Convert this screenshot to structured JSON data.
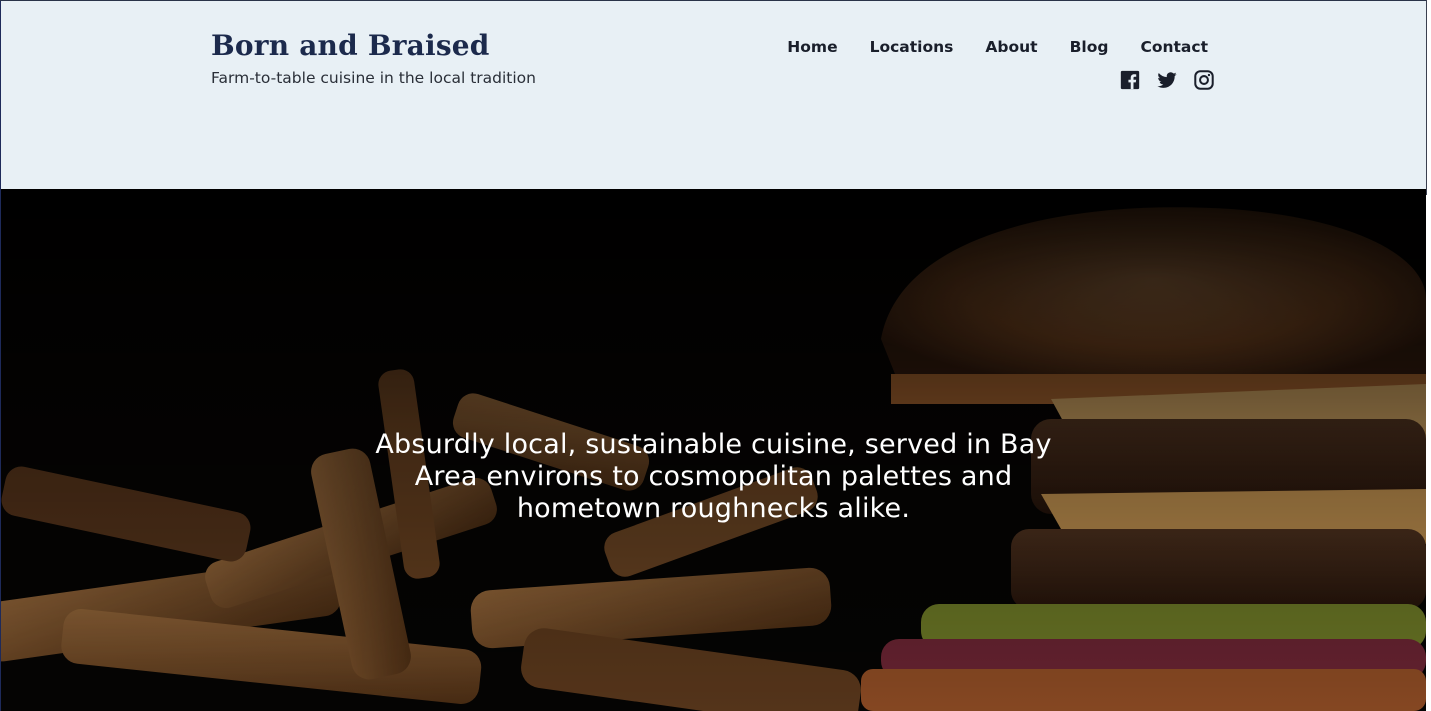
{
  "site": {
    "title": "Born and Braised",
    "tagline": "Farm-to-table cuisine in the local tradition"
  },
  "nav": {
    "items": [
      {
        "label": "Home"
      },
      {
        "label": "Locations"
      },
      {
        "label": "About"
      },
      {
        "label": "Blog"
      },
      {
        "label": "Contact"
      }
    ]
  },
  "social": {
    "icons": [
      "facebook-icon",
      "twitter-icon",
      "instagram-icon"
    ]
  },
  "hero": {
    "headline": "Absurdly local, sustainable cuisine, served in Bay Area environs to cosmopolitan palettes and hometown roughnecks alike.",
    "image": "burger-and-fries-photo"
  },
  "colors": {
    "header_bg": "#e8f0f5",
    "brand": "#1c2a4c",
    "nav_text": "#1a1f2b"
  }
}
